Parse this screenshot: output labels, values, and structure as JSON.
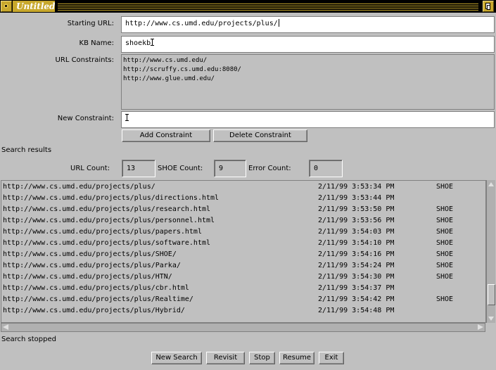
{
  "window": {
    "title": "Untitled",
    "menu_icon": "window-menu-icon",
    "resize_icon": "window-resize-icon"
  },
  "form": {
    "starting_url_label": "Starting URL:",
    "starting_url_value": "http://www.cs.umd.edu/projects/plus/",
    "kb_name_label": "KB Name:",
    "kb_name_value": "shoekb",
    "url_constraints_label": "URL Constraints:",
    "url_constraints": [
      "http://www.cs.umd.edu/",
      "http://scruffy.cs.umd.edu:8080/",
      "http://www.glue.umd.edu/"
    ],
    "new_constraint_label": "New Constraint:",
    "new_constraint_value": "",
    "add_constraint_label": "Add Constraint",
    "delete_constraint_label": "Delete Constraint"
  },
  "search": {
    "title": "Search results",
    "url_count_label": "URL Count:",
    "url_count": "13",
    "shoe_count_label": "SHOE Count:",
    "shoe_count": "9",
    "error_count_label": "Error Count:",
    "error_count": "0",
    "results": [
      {
        "url": "http://www.cs.umd.edu/projects/plus/",
        "time": "2/11/99  3:53:34  PM",
        "tag": "SHOE"
      },
      {
        "url": "http://www.cs.umd.edu/projects/plus/directions.html",
        "time": "2/11/99  3:53:44  PM",
        "tag": ""
      },
      {
        "url": "http://www.cs.umd.edu/projects/plus/research.html",
        "time": "2/11/99  3:53:50  PM",
        "tag": "SHOE"
      },
      {
        "url": "http://www.cs.umd.edu/projects/plus/personnel.html",
        "time": "2/11/99  3:53:56  PM",
        "tag": "SHOE"
      },
      {
        "url": "http://www.cs.umd.edu/projects/plus/papers.html",
        "time": "2/11/99  3:54:03  PM",
        "tag": "SHOE"
      },
      {
        "url": "http://www.cs.umd.edu/projects/plus/software.html",
        "time": "2/11/99  3:54:10  PM",
        "tag": "SHOE"
      },
      {
        "url": "http://www.cs.umd.edu/projects/plus/SHOE/",
        "time": "2/11/99  3:54:16  PM",
        "tag": "SHOE"
      },
      {
        "url": "http://www.cs.umd.edu/projects/plus/Parka/",
        "time": "2/11/99  3:54:24  PM",
        "tag": "SHOE"
      },
      {
        "url": "http://www.cs.umd.edu/projects/plus/HTN/",
        "time": "2/11/99  3:54:30  PM",
        "tag": "SHOE"
      },
      {
        "url": "http://www.cs.umd.edu/projects/plus/cbr.html",
        "time": "2/11/99  3:54:37  PM",
        "tag": ""
      },
      {
        "url": "http://www.cs.umd.edu/projects/plus/Realtime/",
        "time": "2/11/99  3:54:42  PM",
        "tag": "SHOE"
      },
      {
        "url": "http://www.cs.umd.edu/projects/plus/Hybrid/",
        "time": "2/11/99  3:54:48  PM",
        "tag": ""
      }
    ],
    "status": "Search stopped"
  },
  "buttons": {
    "new_search": "New Search",
    "revisit": "Revisit",
    "stop": "Stop",
    "resume": "Resume",
    "exit": "Exit"
  }
}
